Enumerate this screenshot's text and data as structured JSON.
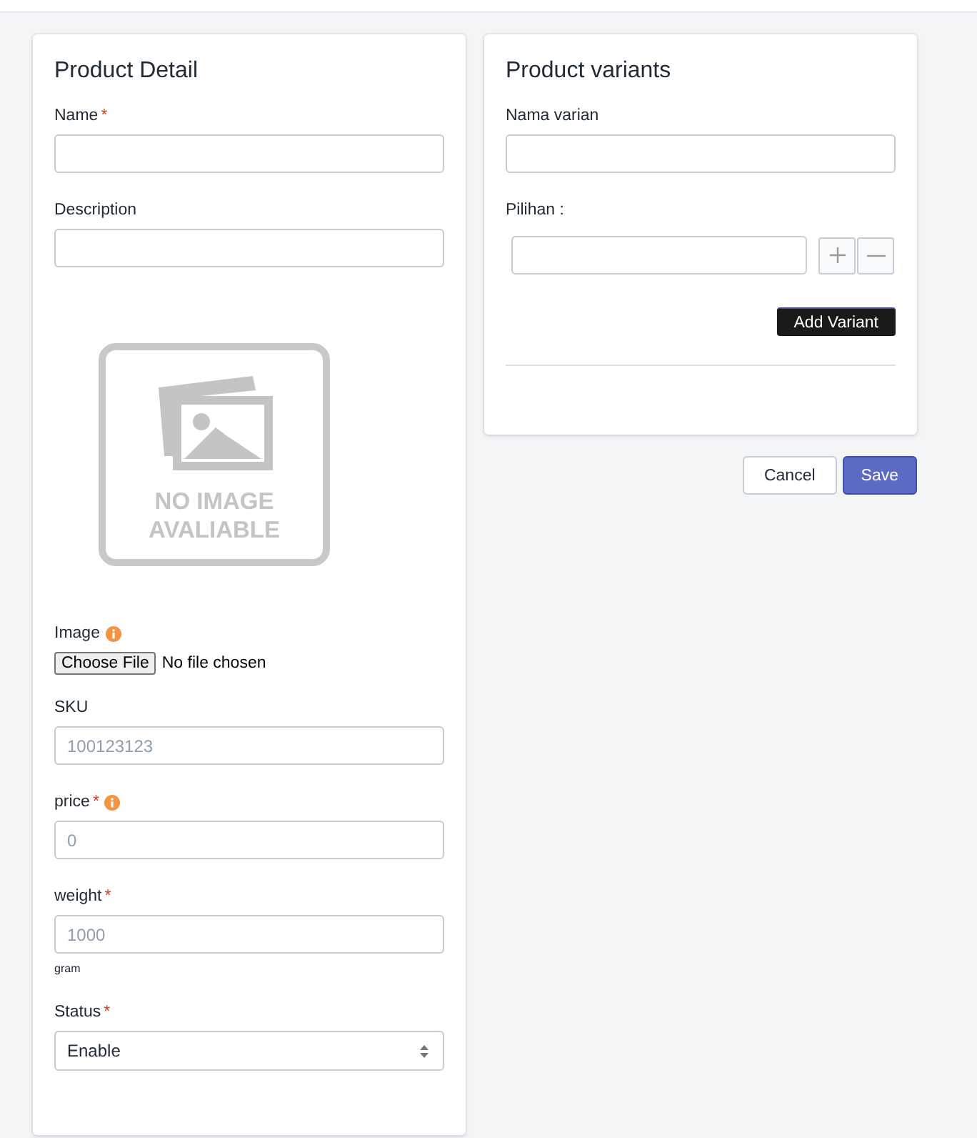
{
  "product_detail": {
    "title": "Product Detail",
    "fields": [
      {
        "kind": "text",
        "label": "Name",
        "required_mark": "*",
        "info": false
      },
      {
        "kind": "text",
        "label": "Description",
        "info": false
      },
      {
        "kind": "image",
        "label": "Image",
        "info": true,
        "placeholder_lines": [
          "NO IMAGE",
          "AVALIABLE"
        ],
        "button": "Choose File",
        "file_status": "No file chosen"
      },
      {
        "kind": "text",
        "label": "SKU",
        "info": false,
        "placeholder": "100123123"
      },
      {
        "kind": "text",
        "label": "price",
        "required_mark": "*",
        "info": true,
        "placeholder": "0"
      },
      {
        "kind": "text",
        "label": "weight",
        "required_mark": "*",
        "info": false,
        "placeholder": "1000",
        "help": "gram"
      },
      {
        "kind": "select",
        "label": "Status",
        "required_mark": "*",
        "info": false,
        "value": "Enable"
      }
    ]
  },
  "product_variants": {
    "title": "Product variants",
    "name_label": "Nama varian",
    "options_label": "Pilihan :",
    "add_button": "Add Variant"
  },
  "actions": [
    {
      "label": "Cancel",
      "kind": "secondary"
    },
    {
      "label": "Save",
      "kind": "primary"
    }
  ]
}
